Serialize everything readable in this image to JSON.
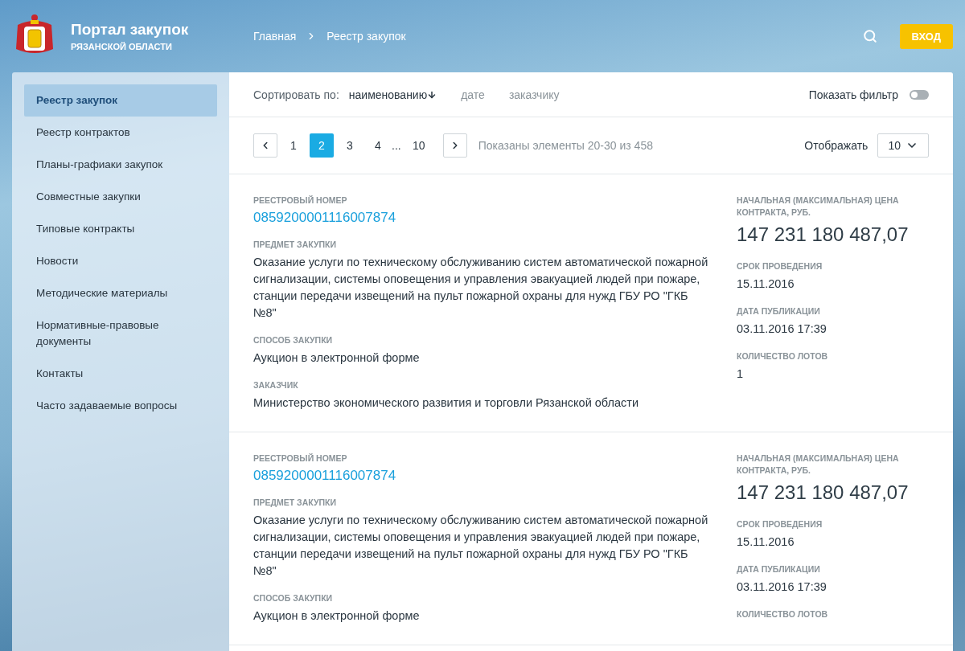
{
  "header": {
    "title": "Портал закупок",
    "subtitle": "РЯЗАНСКОЙ ОБЛАСТИ",
    "breadcrumbs": [
      "Главная",
      "Реестр закупок"
    ],
    "login": "ВХОД"
  },
  "sidebar": {
    "items": [
      {
        "label": "Реестр закупок",
        "selected": true
      },
      {
        "label": "Реестр контрактов",
        "selected": false
      },
      {
        "label": "Планы-графиаки закупок",
        "selected": false
      },
      {
        "label": "Совместные закупки",
        "selected": false
      },
      {
        "label": "Типовые контракты",
        "selected": false
      },
      {
        "label": "Новости",
        "selected": false
      },
      {
        "label": "Методические материалы",
        "selected": false
      },
      {
        "label": "Нормативные-правовые документы",
        "selected": false
      },
      {
        "label": "Контакты",
        "selected": false
      },
      {
        "label": "Часто задаваемые вопросы",
        "selected": false
      }
    ]
  },
  "sort": {
    "label": "Сортировать по:",
    "options": [
      {
        "label": "наименованию",
        "selected": true
      },
      {
        "label": "дате",
        "selected": false
      },
      {
        "label": "заказчику",
        "selected": false
      }
    ]
  },
  "filter": {
    "label": "Показать фильтр",
    "on": false
  },
  "pagination": {
    "pages": [
      {
        "label": "1",
        "kind": "page",
        "selected": false
      },
      {
        "label": "2",
        "kind": "page",
        "selected": true
      },
      {
        "label": "3",
        "kind": "page",
        "selected": false
      },
      {
        "label": "4",
        "kind": "page",
        "selected": false
      },
      {
        "label": "...",
        "kind": "gap"
      },
      {
        "label": "10",
        "kind": "page",
        "selected": false
      }
    ],
    "summary": "Показаны элементы 20-30 из 458",
    "per_page_label": "Отображать",
    "per_page": "10"
  },
  "purchases": [
    {
      "left": [
        {
          "label": "РЕЕСТРОВЫЙ НОМЕР",
          "value": "0859200001116007874",
          "kind": "link"
        },
        {
          "label": "ПРЕДМЕТ ЗАКУПКИ",
          "value": "Оказание услуги по техническому обслуживанию систем автоматической пожарной сигнализации, системы оповещения и управления эвакуацией людей при пожаре, станции передачи извещений на пульт пожарной охраны для нужд ГБУ РО \"ГКБ №8\"",
          "kind": "text"
        },
        {
          "label": "СПОСОБ ЗАКУПКИ",
          "value": "Аукцион в электронной форме",
          "kind": "text"
        },
        {
          "label": "ЗАКАЗЧИК",
          "value": "Министерство экономического развития и торговли Рязанской области",
          "kind": "text"
        }
      ],
      "right": [
        {
          "label": "НАЧАЛЬНАЯ (МАКСИМАЛЬНАЯ) ЦЕНА КОНТРАКТА, РУБ.",
          "value": "147 231 180 487,07",
          "kind": "price"
        },
        {
          "label": "СРОК ПРОВЕДЕНИЯ",
          "value": "15.11.2016",
          "kind": "text"
        },
        {
          "label": "ДАТА ПУБЛИКАЦИИ",
          "value": "03.11.2016 17:39",
          "kind": "text"
        },
        {
          "label": "КОЛИЧЕСТВО ЛОТОВ",
          "value": "1",
          "kind": "text"
        }
      ]
    },
    {
      "left": [
        {
          "label": "РЕЕСТРОВЫЙ НОМЕР",
          "value": "0859200001116007874",
          "kind": "link"
        },
        {
          "label": "ПРЕДМЕТ ЗАКУПКИ",
          "value": "Оказание услуги по техническому обслуживанию систем автоматической пожарной сигнализации, системы оповещения и управления эвакуацией людей при пожаре, станции передачи извещений на пульт пожарной охраны для нужд ГБУ РО \"ГКБ №8\"",
          "kind": "text"
        },
        {
          "label": "СПОСОБ ЗАКУПКИ",
          "value": "Аукцион в электронной форме",
          "kind": "text"
        }
      ],
      "right": [
        {
          "label": "НАЧАЛЬНАЯ (МАКСИМАЛЬНАЯ) ЦЕНА КОНТРАКТА, РУБ.",
          "value": "147 231 180 487,07",
          "kind": "price"
        },
        {
          "label": "СРОК ПРОВЕДЕНИЯ",
          "value": "15.11.2016",
          "kind": "text"
        },
        {
          "label": "ДАТА ПУБЛИКАЦИИ",
          "value": "03.11.2016 17:39",
          "kind": "text"
        },
        {
          "label": "КОЛИЧЕСТВО ЛОТОВ"
        }
      ]
    }
  ]
}
